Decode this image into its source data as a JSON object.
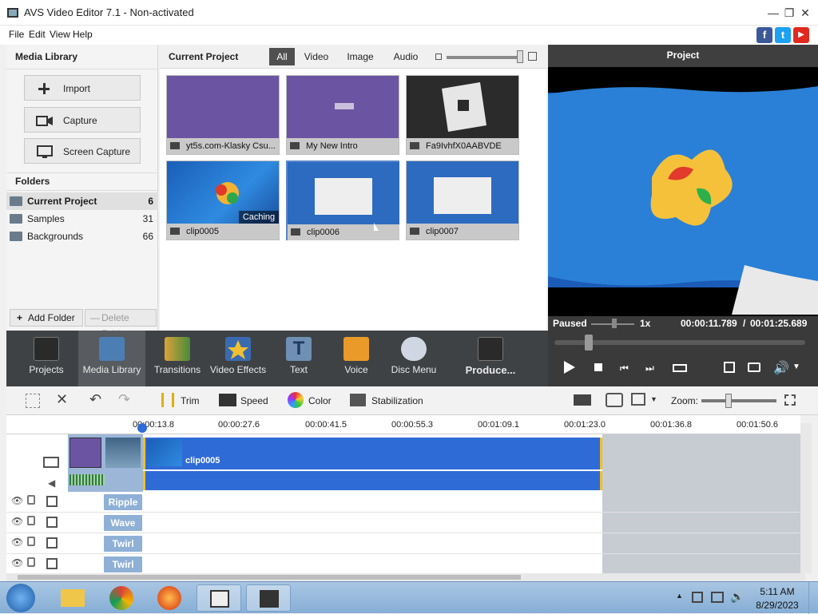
{
  "window": {
    "title": "AVS Video Editor 7.1 - Non-activated"
  },
  "menu": [
    "File",
    "Edit",
    "View",
    "Help"
  ],
  "social": [
    {
      "name": "facebook-icon",
      "glyph": "f",
      "color": "#3b5998"
    },
    {
      "name": "twitter-icon",
      "glyph": "t",
      "color": "#1da1f2"
    },
    {
      "name": "youtube-icon",
      "glyph": "▶",
      "color": "#e02a20"
    }
  ],
  "media_library": {
    "title": "Media Library",
    "buttons": [
      "Import",
      "Capture",
      "Screen Capture"
    ],
    "folders_title": "Folders",
    "folders": [
      {
        "name": "Current Project",
        "count": "6"
      },
      {
        "name": "Samples",
        "count": "31"
      },
      {
        "name": "Backgrounds",
        "count": "66"
      }
    ],
    "add_folder": "Add Folder",
    "delete_folder": "Delete Folder"
  },
  "current_project": {
    "title": "Current Project",
    "filters": [
      "All",
      "Video",
      "Image",
      "Audio"
    ],
    "active_filter": "All",
    "clips": [
      {
        "name": "yt5s.com-Klasky Csu...",
        "kind": "video",
        "caching": ""
      },
      {
        "name": "My New Intro",
        "kind": "video",
        "caching": ""
      },
      {
        "name": "Fa9IvhfX0AABVDE",
        "kind": "image",
        "caching": ""
      },
      {
        "name": "clip0005",
        "kind": "video",
        "caching": "Caching"
      },
      {
        "name": "clip0006",
        "kind": "video",
        "caching": ""
      },
      {
        "name": "clip0007",
        "kind": "video",
        "caching": ""
      }
    ]
  },
  "preview": {
    "title": "Project",
    "state": "Paused",
    "speed": "1x",
    "current_time": "00:00:11.789",
    "separator": "/",
    "total_time": "00:01:25.689"
  },
  "toolbar": [
    "Projects",
    "Media Library",
    "Transitions",
    "Video Effects",
    "Text",
    "Voice",
    "Disc Menu",
    "Produce..."
  ],
  "edit_toolbar": {
    "trim": "Trim",
    "speed": "Speed",
    "color": "Color",
    "stabilization": "Stabilization",
    "zoom": "Zoom:"
  },
  "timeline": {
    "ticks": [
      "00:00:13.8",
      "00:00:27.6",
      "00:00:41.5",
      "00:00:55.3",
      "00:01:09.1",
      "00:01:23.0",
      "00:01:36.8",
      "00:01:50.6"
    ],
    "main_clip": "clip0005",
    "effects": [
      "Ripple",
      "Wave",
      "Twirl",
      "Twirl"
    ]
  },
  "taskbar": {
    "time": "5:11 AM",
    "date": "8/29/2023"
  }
}
